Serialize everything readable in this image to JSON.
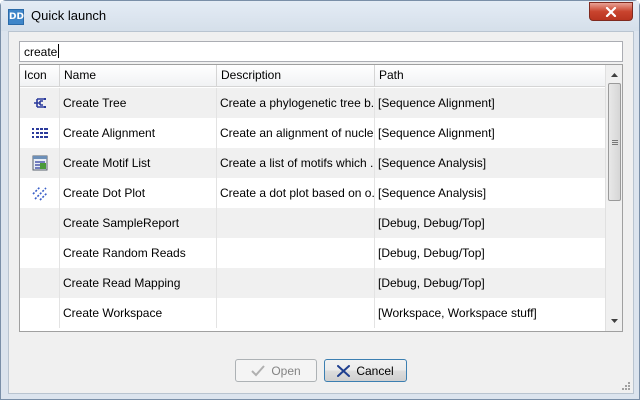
{
  "window": {
    "app_icon_text": "DD",
    "title": "Quick launch"
  },
  "search": {
    "value": "create"
  },
  "table": {
    "columns": [
      "Icon",
      "Name",
      "Description",
      "Path"
    ],
    "rows": [
      {
        "icon": "tree-icon",
        "name": "Create Tree",
        "description": "Create a phylogenetic tree b...",
        "path": "[Sequence Alignment]"
      },
      {
        "icon": "alignment-icon",
        "name": "Create Alignment",
        "description": "Create an alignment of nucle...",
        "path": "[Sequence Alignment]"
      },
      {
        "icon": "motif-list-icon",
        "name": "Create Motif List",
        "description": "Create a list of motifs which ...",
        "path": "[Sequence Analysis]"
      },
      {
        "icon": "dot-plot-icon",
        "name": "Create Dot Plot",
        "description": "Create a dot plot based on o...",
        "path": "[Sequence Analysis]"
      },
      {
        "icon": "",
        "name": "Create SampleReport",
        "description": "",
        "path": "[Debug, Debug/Top]"
      },
      {
        "icon": "",
        "name": "Create Random Reads",
        "description": "",
        "path": "[Debug, Debug/Top]"
      },
      {
        "icon": "",
        "name": "Create Read Mapping",
        "description": "",
        "path": "[Debug, Debug/Top]"
      },
      {
        "icon": "",
        "name": "Create Workspace",
        "description": "",
        "path": "[Workspace, Workspace stuff]"
      }
    ]
  },
  "buttons": {
    "open_label": "Open",
    "cancel_label": "Cancel"
  },
  "colors": {
    "accent": "#3f86c9",
    "cancel_icon": "#1f3f8f",
    "close_button": "#c9442e"
  }
}
